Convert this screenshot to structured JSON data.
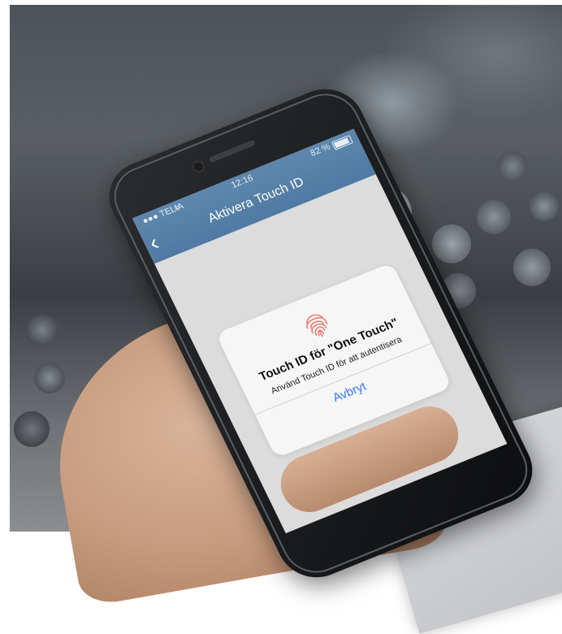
{
  "status_bar": {
    "carrier": "TELIA",
    "time": "12:16",
    "battery": "82 %"
  },
  "navbar": {
    "back_icon": "chevron-left-icon",
    "title": "Aktivera Touch ID"
  },
  "dialog": {
    "icon": "fingerprint-icon",
    "title": "Touch ID för \"One Touch\"",
    "subtitle": "Använd Touch ID för att autentisera",
    "cancel_label": "Avbryt"
  },
  "colors": {
    "navbar": "#4f7aa3",
    "screen_background": "#dcdcdc",
    "dialog_background": "#f6f6f6",
    "link": "#3478f0",
    "fingerprint": "#e87b74"
  }
}
